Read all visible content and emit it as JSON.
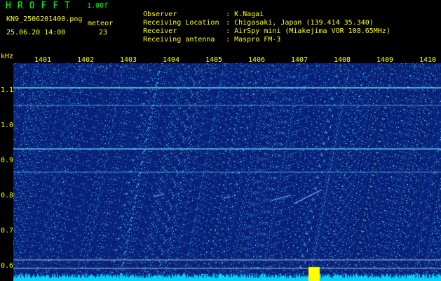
{
  "header": {
    "app_title": "HROFFT",
    "version": "1.00f",
    "filename": "KN9_2506201400.png",
    "station_label": "meteor",
    "datetime": "25.06.20 14:00",
    "count": "23",
    "info": [
      {
        "label": "Observer",
        "value": "K.Nagai"
      },
      {
        "label": "Receiving Location",
        "value": "Chigasaki, Japan (139.414 35.340)"
      },
      {
        "label": "Receiver",
        "value": "AirSpy mini (Miakejima VOR 108.65MHz)"
      },
      {
        "label": "Receiving antenna",
        "value": "Maspro FM-3"
      }
    ]
  },
  "axes": {
    "y_unit": "kHz",
    "x_ticks": [
      "1401",
      "1402",
      "1403",
      "1404",
      "1405",
      "1406",
      "1407",
      "1408",
      "1409",
      "1410"
    ],
    "y_ticks": [
      "1.1",
      "1.0",
      "0.9",
      "0.8",
      "0.7",
      "0.6"
    ]
  },
  "colors": {
    "background": "#000000",
    "header_green": "#00ff00",
    "text_yellow": "#ffff00",
    "spectrogram_base": "#0a1a70",
    "noise_floor": "#00c8ff"
  }
}
